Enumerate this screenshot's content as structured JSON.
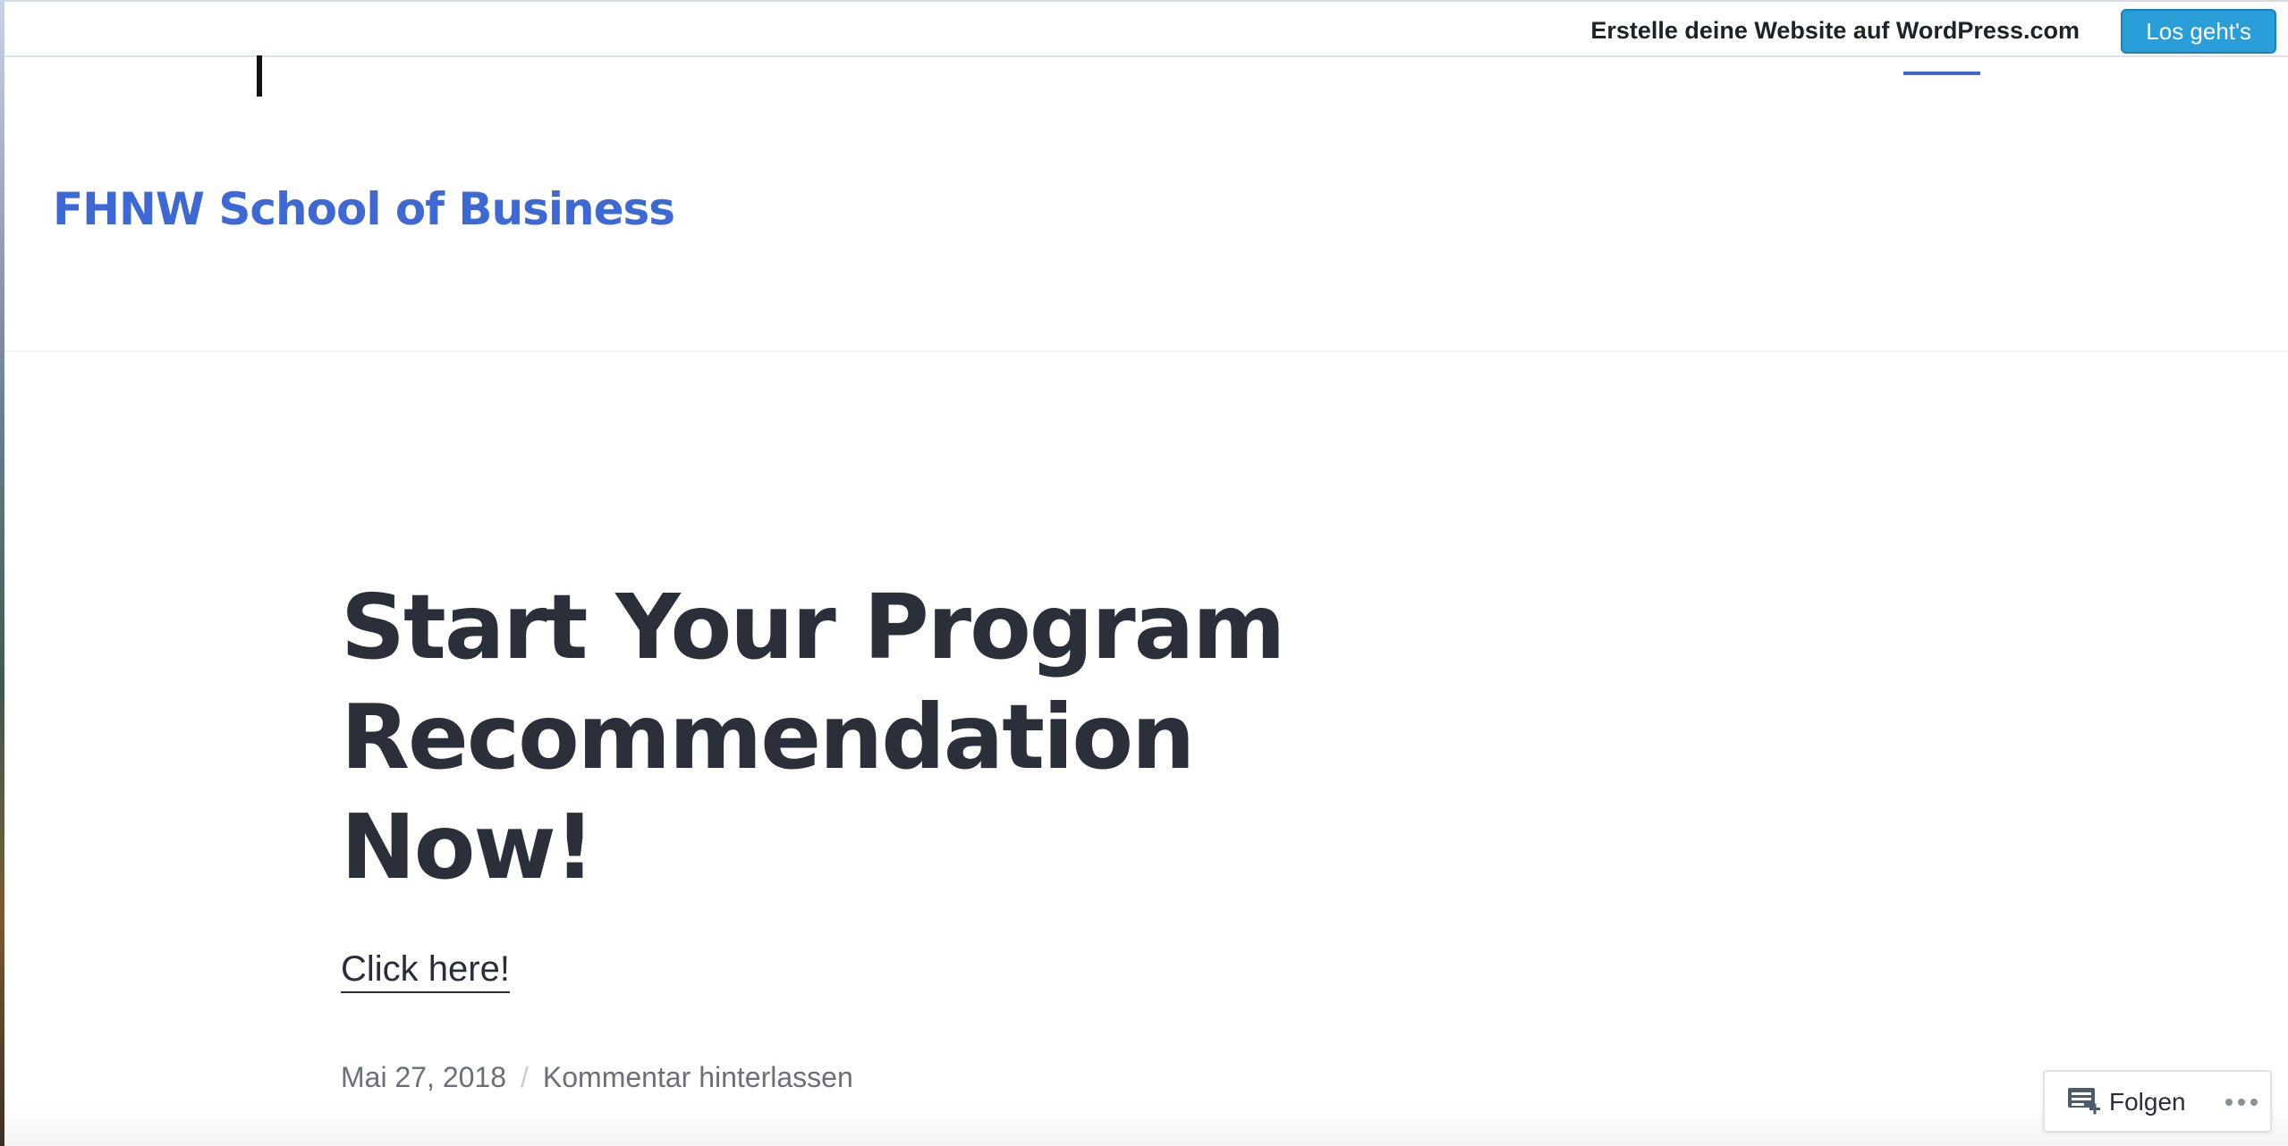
{
  "wp_bar": {
    "promo_text": "Erstelle deine Website auf WordPress.com",
    "cta_label": "Los geht's",
    "cta_color": "#2a9ed8"
  },
  "header": {
    "site_title": "FHNW School of Business",
    "title_color": "#3e69d4"
  },
  "post": {
    "title": "Start Your Program Recommendation Now!",
    "link_text": "Click here!",
    "date": "Mai 27, 2018",
    "separator": "/",
    "comment_link": "Kommentar hinterlassen"
  },
  "follow": {
    "label": "Folgen",
    "icon": "follow-reader-icon",
    "more_icon": "ellipsis-icon"
  }
}
